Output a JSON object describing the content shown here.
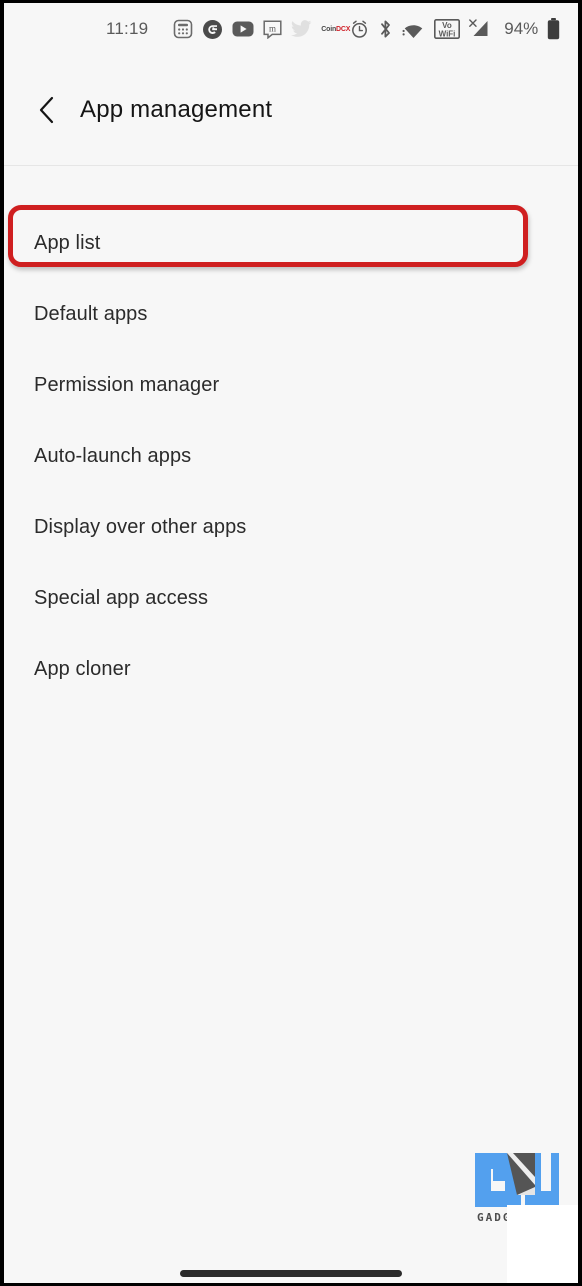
{
  "statusbar": {
    "time": "11:19",
    "battery_text": "94%",
    "notification_icons": [
      {
        "name": "calculator-icon",
        "label": "Calculator"
      },
      {
        "name": "google-icon",
        "label": "G"
      },
      {
        "name": "youtube-icon",
        "label": "YouTube"
      },
      {
        "name": "mint-icon",
        "label": "m"
      },
      {
        "name": "twitter-icon",
        "label": "Twitter"
      },
      {
        "name": "coindcx-icon",
        "label_part1": "Coin",
        "label_part2": "DCX"
      }
    ],
    "system_icons": [
      {
        "name": "alarm-icon",
        "label": "Alarm"
      },
      {
        "name": "bluetooth-icon",
        "label": "Bluetooth"
      },
      {
        "name": "wifi-icon",
        "label": "Wi-Fi"
      },
      {
        "name": "vowifi-icon",
        "line1": "Vo",
        "line2": "WiFi"
      },
      {
        "name": "cellular-signal-icon",
        "label": "No SIM"
      },
      {
        "name": "battery-icon",
        "label": "Battery"
      }
    ]
  },
  "header": {
    "title": "App management",
    "back_label": "Back"
  },
  "list": {
    "items": [
      {
        "label": "App list",
        "highlighted": true
      },
      {
        "label": "Default apps",
        "highlighted": false
      },
      {
        "label": "Permission manager",
        "highlighted": false
      },
      {
        "label": "Auto-launch apps",
        "highlighted": false
      },
      {
        "label": "Display over other apps",
        "highlighted": false
      },
      {
        "label": "Special app access",
        "highlighted": false
      },
      {
        "label": "App cloner",
        "highlighted": false
      }
    ]
  },
  "annotation": {
    "highlight_color": "#cf1f20",
    "target": "App list"
  },
  "watermark": {
    "text": "GADG",
    "logo_blue": "#53a0ee",
    "logo_dark": "#555555"
  },
  "colors": {
    "background": "#f7f7f7",
    "text_primary": "#2b2b2b",
    "title": "#151515",
    "status_text": "#5a5a5a",
    "separator": "#e6e6e6"
  }
}
